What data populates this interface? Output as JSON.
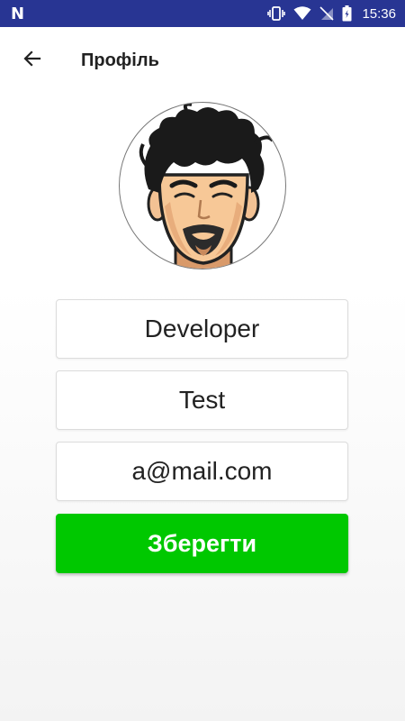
{
  "status_bar": {
    "left_icon": "n-notification-icon",
    "left_text": "N",
    "icons": [
      "vibrate-icon",
      "wifi-icon",
      "no-sim-icon",
      "battery-icon"
    ],
    "time": "15:36",
    "background": "#283593"
  },
  "app_bar": {
    "back_icon": "arrow-left-icon",
    "title": "Профіль"
  },
  "profile": {
    "avatar_icon": "avatar-cartoon-face",
    "first_name": "Developer",
    "last_name": "Test",
    "email": "a@mail.com"
  },
  "actions": {
    "save_label": "Зберегти",
    "save_color": "#00c800"
  }
}
